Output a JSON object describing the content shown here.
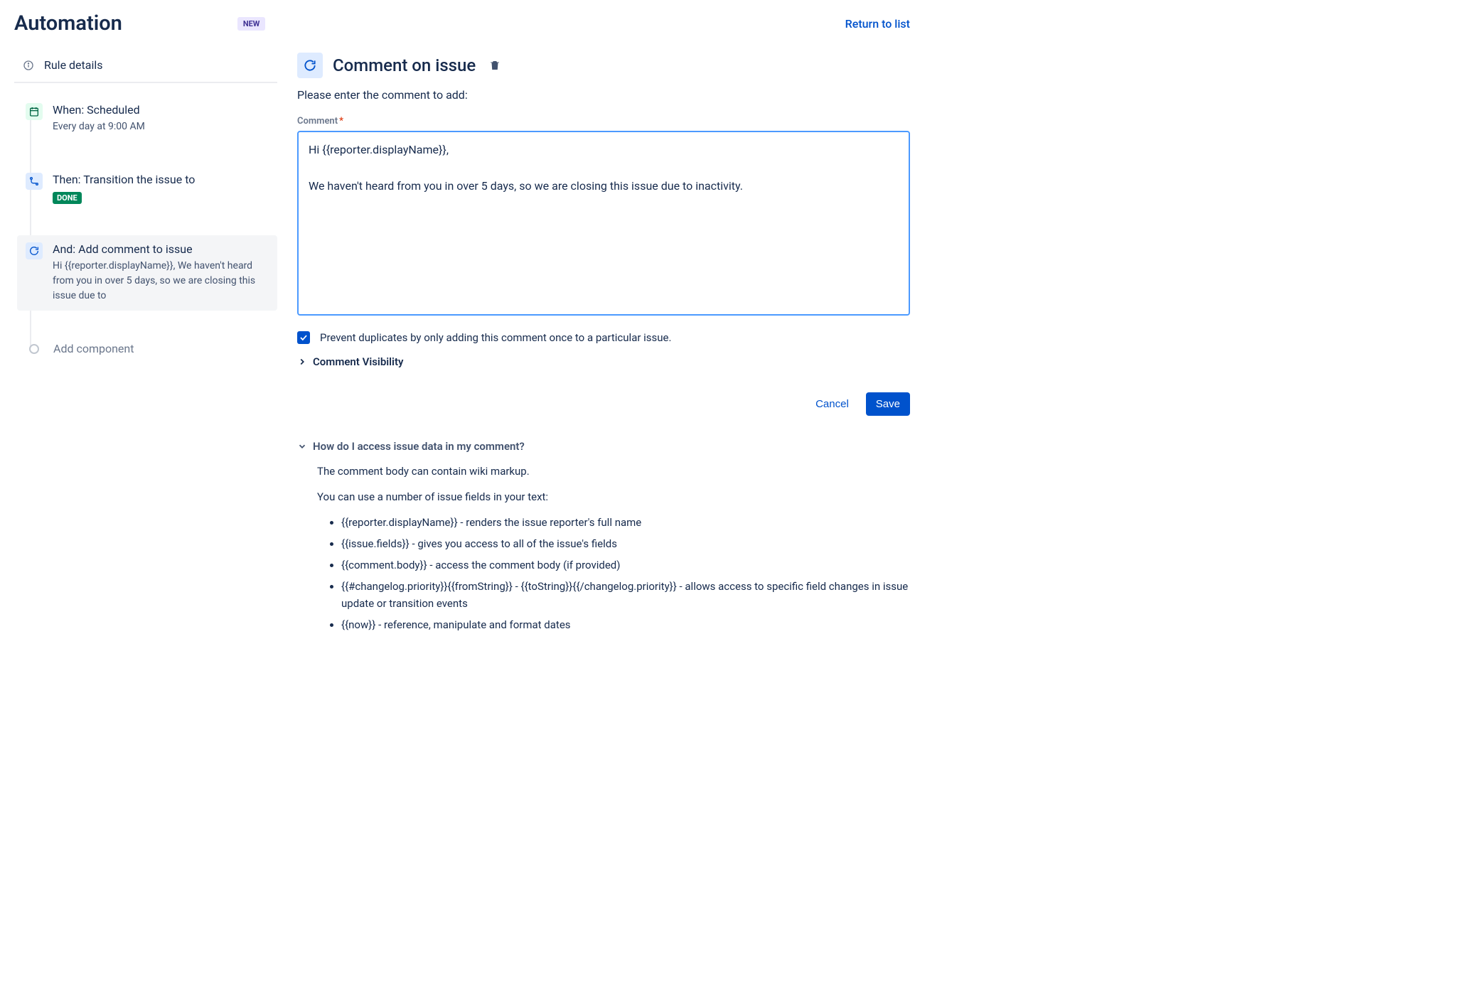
{
  "header": {
    "title": "Automation",
    "badge": "NEW",
    "return_link": "Return to list"
  },
  "sidebar": {
    "rule_details": "Rule details",
    "steps": [
      {
        "title": "When: Scheduled",
        "subtitle": "Every day at 9:00 AM",
        "icon": "calendar",
        "kind": "trigger"
      },
      {
        "title": "Then: Transition the issue to",
        "lozenge": "DONE",
        "icon": "branch",
        "kind": "action"
      },
      {
        "title": "And: Add comment to issue",
        "subtitle": "Hi {{reporter.displayName}}, We haven't heard from you in over 5 days, so we are closing this issue due to",
        "icon": "refresh",
        "kind": "action",
        "active": true
      }
    ],
    "add_component": "Add component"
  },
  "main": {
    "title": "Comment on issue",
    "instruction": "Please enter the comment to add:",
    "field_label": "Comment",
    "comment_value": "Hi {{reporter.displayName}},\n\nWe haven't heard from you in over 5 days, so we are closing this issue due to inactivity.",
    "prevent_duplicates": "Prevent duplicates by only adding this comment once to a particular issue.",
    "comment_visibility": "Comment Visibility",
    "cancel": "Cancel",
    "save": "Save"
  },
  "help": {
    "title": "How do I access issue data in my comment?",
    "line1": "The comment body can contain wiki markup.",
    "line2": "You can use a number of issue fields in your text:",
    "items": [
      "{{reporter.displayName}} - renders the issue reporter's full name",
      "{{issue.fields}} - gives you access to all of the issue's fields",
      "{{comment.body}} - access the comment body (if provided)",
      "{{#changelog.priority}}{{fromString}} - {{toString}}{{/changelog.priority}} - allows access to specific field changes in issue update or transition events",
      "{{now}} - reference, manipulate and format dates"
    ]
  }
}
